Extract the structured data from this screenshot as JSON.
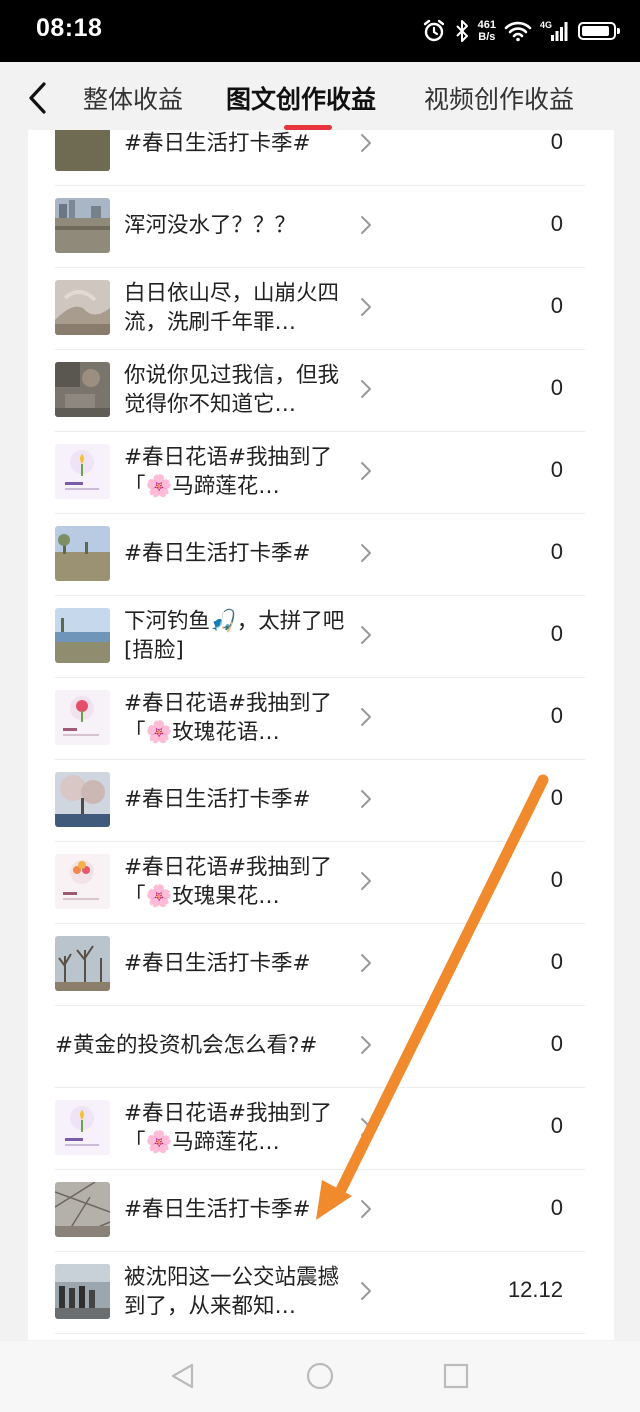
{
  "status_bar": {
    "time": "08:18",
    "net_speed_value": "461",
    "net_speed_unit": "B/s",
    "battery_level": 0.9,
    "icons": [
      "alarm-icon",
      "bluetooth-icon",
      "wifi-icon",
      "signal-4g-icon",
      "battery-icon"
    ]
  },
  "header": {
    "tabs": [
      {
        "label": "整体收益",
        "active": false
      },
      {
        "label": "图文创作收益",
        "active": true
      },
      {
        "label": "视频创作收益",
        "active": false
      }
    ],
    "accent_color": "#e8343c"
  },
  "list": [
    {
      "title": "#春日生活打卡季#",
      "value": "0",
      "thumb": "field"
    },
    {
      "title": "浑河没水了？？？",
      "value": "0",
      "thumb": "riverbed"
    },
    {
      "title": "白日依山尽，山崩火四流，洗刷千年罪…",
      "value": "0",
      "thumb": "fire"
    },
    {
      "title": "你说你见过我信，但我觉得你不知道它…",
      "value": "0",
      "thumb": "rocks"
    },
    {
      "title": "#春日花语#我抽到了「🌸马蹄莲花…",
      "value": "0",
      "thumb": "flower-card-yellow"
    },
    {
      "title": "#春日生活打卡季#",
      "value": "0",
      "thumb": "trees-sky"
    },
    {
      "title": "下河钓鱼🎣，太拼了吧[捂脸]",
      "value": "0",
      "thumb": "river-sky"
    },
    {
      "title": "#春日花语#我抽到了「🌸玫瑰花语…",
      "value": "0",
      "thumb": "flower-card-red"
    },
    {
      "title": "#春日生活打卡季#",
      "value": "0",
      "thumb": "blossom"
    },
    {
      "title": "#春日花语#我抽到了「🌸玫瑰果花…",
      "value": "0",
      "thumb": "flower-card-orange"
    },
    {
      "title": "#春日生活打卡季#",
      "value": "0",
      "thumb": "bare-trees"
    },
    {
      "title": "#黄金的投资机会怎么看?#",
      "value": "0",
      "thumb": "none"
    },
    {
      "title": "#春日花语#我抽到了「🌸马蹄莲花…",
      "value": "0",
      "thumb": "flower-card-yellow"
    },
    {
      "title": "#春日生活打卡季#",
      "value": "0",
      "thumb": "branches"
    },
    {
      "title": "被沈阳这一公交站震撼到了，从来都知…",
      "value": "12.12",
      "thumb": "bus-stop"
    }
  ],
  "bottom_nav": {
    "icons": [
      "back-triangle-icon",
      "home-circle-icon",
      "recents-square-icon"
    ]
  },
  "annotation": {
    "color": "#f08a2c",
    "icon": "arrow-annotation"
  }
}
